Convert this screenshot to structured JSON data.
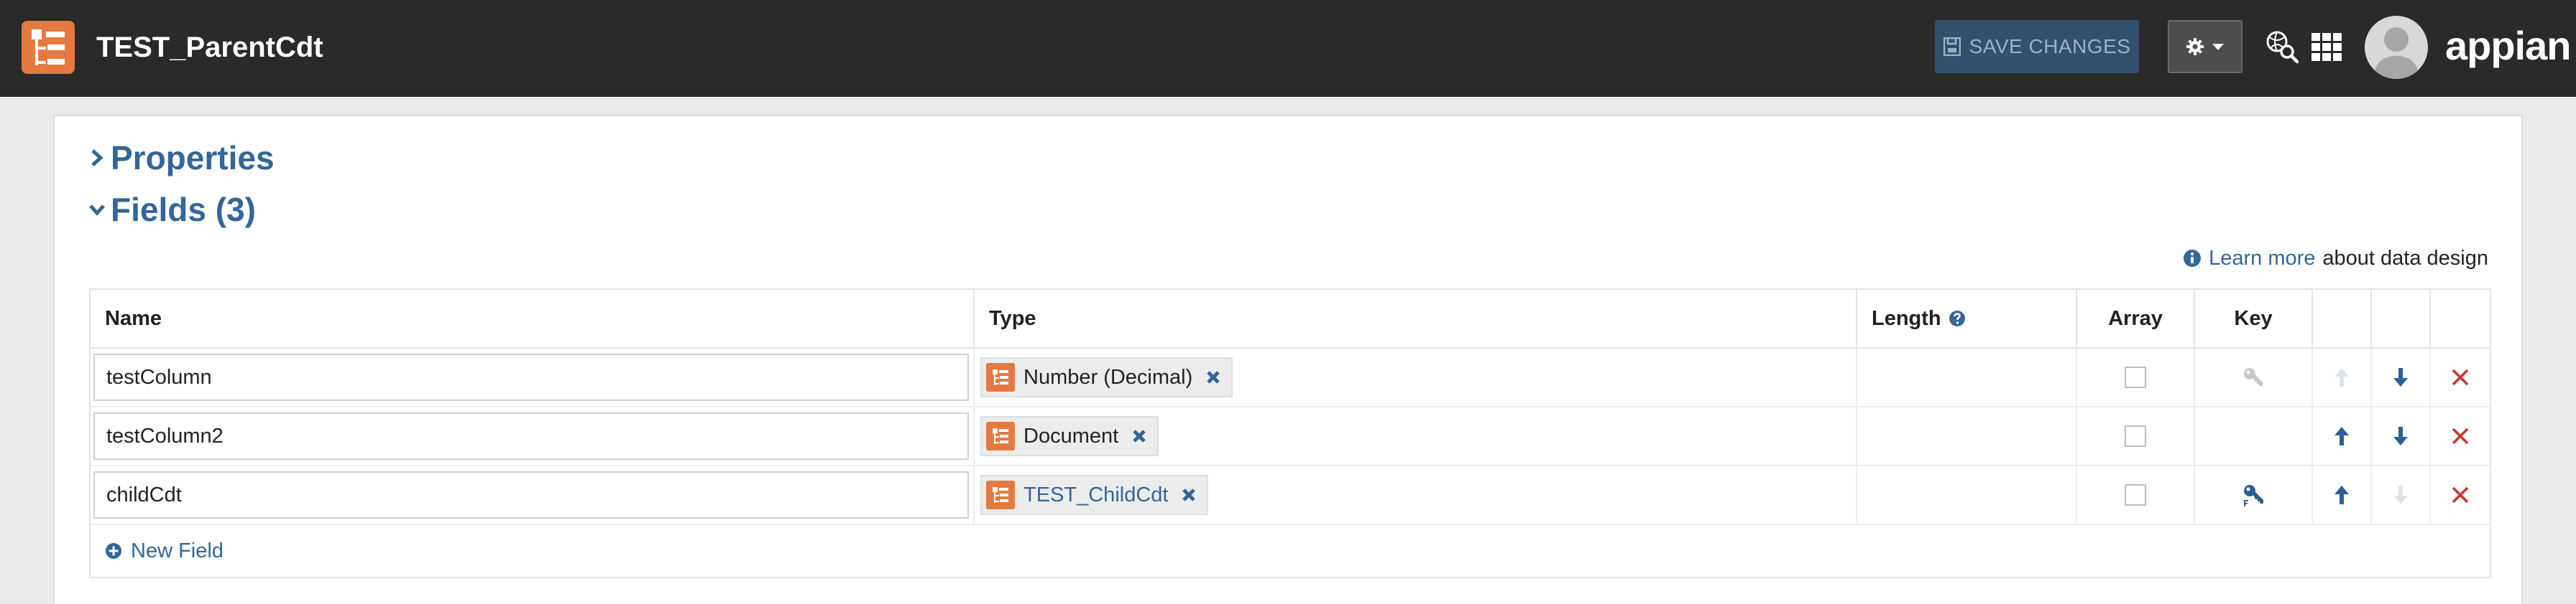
{
  "header": {
    "title": "TEST_ParentCdt",
    "save_label": "SAVE CHANGES",
    "brand": "appian"
  },
  "sections": {
    "properties_label": "Properties",
    "fields_label": "Fields (3)"
  },
  "help": {
    "link_text": "Learn more",
    "rest_text": "about data design"
  },
  "table": {
    "columns": [
      "Name",
      "Type",
      "Length",
      "Array",
      "Key"
    ],
    "rows": [
      {
        "name": "testColumn",
        "type": "Number (Decimal)",
        "type_is_link": false,
        "array": false,
        "key": "primary-key-inactive",
        "can_move_up": false,
        "can_move_down": true
      },
      {
        "name": "testColumn2",
        "type": "Document",
        "type_is_link": false,
        "array": false,
        "key": "none",
        "can_move_up": true,
        "can_move_down": true
      },
      {
        "name": "childCdt",
        "type": "TEST_ChildCdt",
        "type_is_link": true,
        "array": false,
        "key": "foreign-key",
        "can_move_up": true,
        "can_move_down": false
      }
    ],
    "new_field_label": "New Field"
  },
  "colors": {
    "topbar": "#2a2a2a",
    "accent_orange": "#e5793f",
    "link_blue": "#336699",
    "delete_red": "#cc3333",
    "save_button": "#34506f"
  }
}
